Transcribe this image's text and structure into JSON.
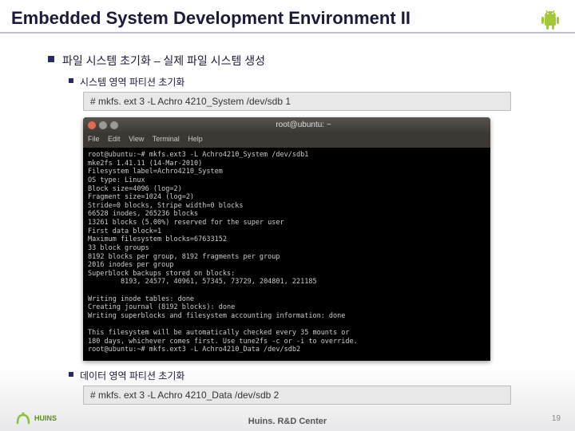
{
  "title": "Embedded System Development Environment II",
  "bullet_main": "파일 시스템 초기화 – 실제 파일 시스템 생성",
  "bullet_sub1": "시스템 영역 파티션 초기화",
  "cmd1": "# mkfs. ext 3 -L Achro 4210_System /dev/sdb 1",
  "terminal": {
    "title_prefix": "root@ubuntu: ~",
    "menu": [
      "File",
      "Edit",
      "View",
      "Terminal",
      "Help"
    ],
    "lines": [
      "root@ubuntu:~# mkfs.ext3 -L Achro4210_System /dev/sdb1",
      "mke2fs 1.41.11 (14-Mar-2010)",
      "Filesystem label=Achro4210_System",
      "OS type: Linux",
      "Block size=4096 (log=2)",
      "Fragment size=1024 (log=2)",
      "Stride=0 blocks, Stripe width=0 blocks",
      "66528 inodes, 265236 blocks",
      "13261 blocks (5.00%) reserved for the super user",
      "First data block=1",
      "Maximum filesystem blocks=67633152",
      "33 block groups",
      "8192 blocks per group, 8192 fragments per group",
      "2016 inodes per group",
      "Superblock backups stored on blocks:",
      "        8193, 24577, 40961, 57345, 73729, 204801, 221185",
      "",
      "Writing inode tables: done",
      "Creating journal (8192 blocks): done",
      "Writing superblocks and filesystem accounting information: done",
      "",
      "This filesystem will be automatically checked every 35 mounts or",
      "180 days, whichever comes first. Use tune2fs -c or -i to override.",
      "root@ubuntu:~# mkfs.ext3 -L Achro4210_Data /dev/sdb2"
    ]
  },
  "bullet_sub2": "데이터 영역 파티션 초기화",
  "cmd2": "# mkfs. ext 3 -L Achro 4210_Data /dev/sdb 2",
  "footer": "Huins. R&D Center",
  "page": "19",
  "logo_name": "HUINS"
}
